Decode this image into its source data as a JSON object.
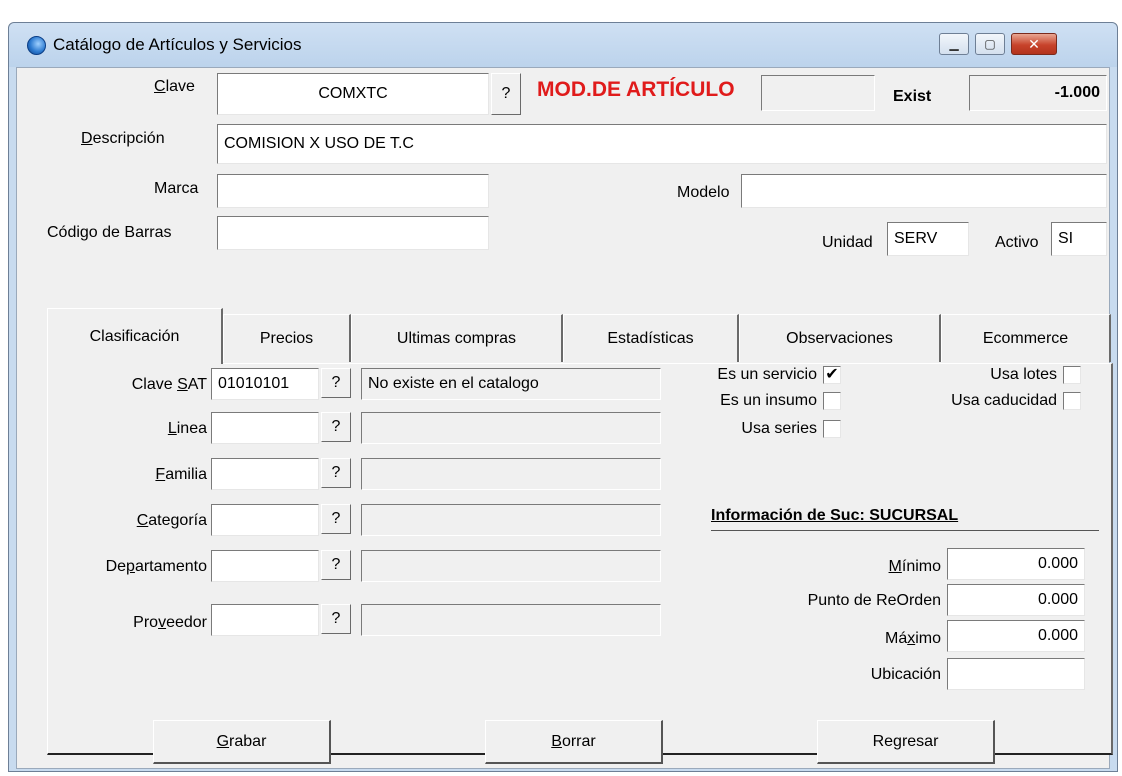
{
  "window": {
    "title": "Catálogo de Artículos y Servicios",
    "minimize": "▁",
    "maximize": "▢",
    "close": "✕"
  },
  "header": {
    "clave_label_u": "C",
    "clave_label_rest": "lave",
    "clave_value": "COMXTC",
    "help_glyph": "?",
    "mode_text": "MOD.DE ARTÍCULO",
    "exist_label": "Exist",
    "exist_value": "-1.000",
    "descripcion_label_u": "D",
    "descripcion_label_rest": "escripción",
    "descripcion_value": "COMISION X USO DE T.C",
    "marca_label": "Marca",
    "marca_value": "",
    "modelo_label": "Modelo",
    "modelo_value": "",
    "barras_label": "Código de Barras",
    "barras_value": "",
    "unidad_label": "Unidad",
    "unidad_value": "SERV",
    "activo_label": "Activo",
    "activo_value": "SI"
  },
  "tabs": [
    {
      "label": "Clasificación"
    },
    {
      "label": "Precios"
    },
    {
      "label": "Ultimas compras"
    },
    {
      "label": "Estadísticas"
    },
    {
      "label": "Observaciones"
    },
    {
      "label": "Ecommerce"
    }
  ],
  "clasificacion": {
    "clave_sat": {
      "pre": "Clave ",
      "u": "S",
      "post": "AT",
      "value": "01010101",
      "desc": "No existe en el catalogo"
    },
    "linea": {
      "pre": "",
      "u": "L",
      "post": "inea",
      "value": "",
      "desc": ""
    },
    "familia": {
      "pre": "",
      "u": "F",
      "post": "amilia",
      "value": "",
      "desc": ""
    },
    "categoria": {
      "pre": "",
      "u": "C",
      "post": "ategoría",
      "value": "",
      "desc": ""
    },
    "departamento": {
      "pre": "De",
      "u": "p",
      "post": "artamento",
      "value": "",
      "desc": ""
    },
    "proveedor": {
      "pre": "Pro",
      "u": "v",
      "post": "eedor",
      "value": "",
      "desc": ""
    }
  },
  "checks": {
    "es_servicio": {
      "label": "Es un servicio",
      "mark": "✔"
    },
    "es_insumo": {
      "label": "Es un insumo",
      "mark": ""
    },
    "usa_series": {
      "label": "Usa series",
      "mark": ""
    },
    "usa_lotes": {
      "label": "Usa lotes",
      "mark": ""
    },
    "usa_caducidad": {
      "label": "Usa caducidad",
      "mark": ""
    }
  },
  "sucursal": {
    "title": "Información de Suc: SUCURSAL",
    "minimo": {
      "pre": "",
      "u": "M",
      "post": "ínimo",
      "value": "0.000"
    },
    "punto_reorden": {
      "label": "Punto de ReOrden",
      "value": "0.000"
    },
    "maximo": {
      "pre": "Má",
      "u": "x",
      "post": "imo",
      "value": "0.000"
    },
    "ubicacion": {
      "label": "Ubicación",
      "value": ""
    }
  },
  "buttons": {
    "grabar": {
      "u": "G",
      "rest": "rabar"
    },
    "borrar": {
      "u": "B",
      "rest": "orrar"
    },
    "regresar": {
      "label": "Regresar"
    }
  }
}
